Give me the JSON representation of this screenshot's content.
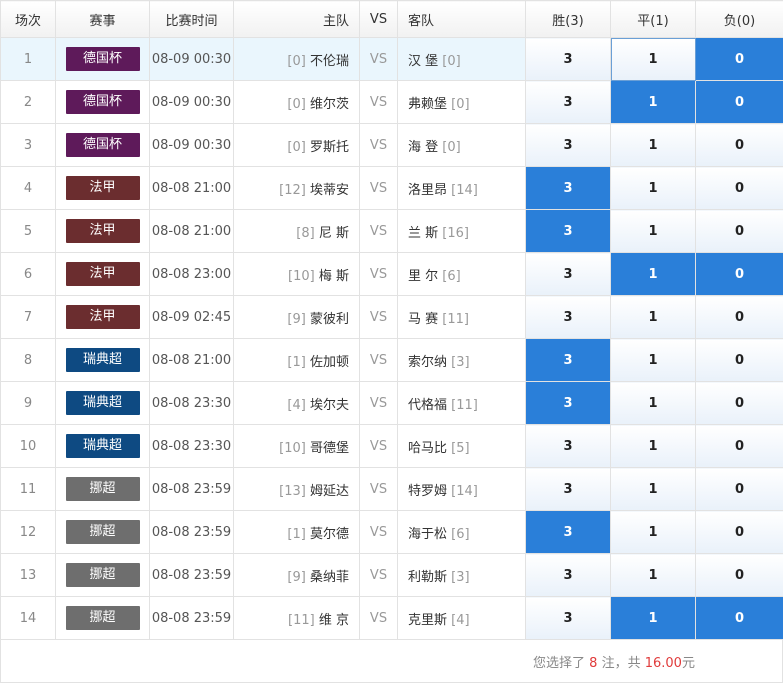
{
  "header": {
    "col_no": "场次",
    "col_league": "赛事",
    "col_time": "比赛时间",
    "col_home": "主队",
    "col_vs": "VS",
    "col_away": "客队",
    "col_win": "胜(3)",
    "col_draw": "平(1)",
    "col_loss": "负(0)"
  },
  "colors": {
    "德国杯": "#5e1a5a",
    "法甲": "#6b2d2f",
    "瑞典超": "#0e4a82",
    "挪超": "#6e6e6e",
    "selected": "#2a7fd9"
  },
  "rows": [
    {
      "no": "1",
      "league": "德国杯",
      "time": "08-09 00:30",
      "home_rank": "[0]",
      "home": "不伦瑞",
      "vs": "VS",
      "away": "汉 堡",
      "away_rank": "[0]",
      "win": "3",
      "draw": "1",
      "loss": "0",
      "sel": [
        "loss"
      ],
      "focus": "draw",
      "hl": true
    },
    {
      "no": "2",
      "league": "德国杯",
      "time": "08-09 00:30",
      "home_rank": "[0]",
      "home": "维尔茨",
      "vs": "VS",
      "away": "弗赖堡",
      "away_rank": "[0]",
      "win": "3",
      "draw": "1",
      "loss": "0",
      "sel": [
        "draw",
        "loss"
      ]
    },
    {
      "no": "3",
      "league": "德国杯",
      "time": "08-09 00:30",
      "home_rank": "[0]",
      "home": "罗斯托",
      "vs": "VS",
      "away": "海 登",
      "away_rank": "[0]",
      "win": "3",
      "draw": "1",
      "loss": "0",
      "sel": []
    },
    {
      "no": "4",
      "league": "法甲",
      "time": "08-08 21:00",
      "home_rank": "[12]",
      "home": "埃蒂安",
      "vs": "VS",
      "away": "洛里昂",
      "away_rank": "[14]",
      "win": "3",
      "draw": "1",
      "loss": "0",
      "sel": [
        "win"
      ]
    },
    {
      "no": "5",
      "league": "法甲",
      "time": "08-08 21:00",
      "home_rank": "[8]",
      "home": "尼 斯",
      "vs": "VS",
      "away": "兰 斯",
      "away_rank": "[16]",
      "win": "3",
      "draw": "1",
      "loss": "0",
      "sel": [
        "win"
      ]
    },
    {
      "no": "6",
      "league": "法甲",
      "time": "08-08 23:00",
      "home_rank": "[10]",
      "home": "梅 斯",
      "vs": "VS",
      "away": "里 尔",
      "away_rank": "[6]",
      "win": "3",
      "draw": "1",
      "loss": "0",
      "sel": [
        "draw",
        "loss"
      ]
    },
    {
      "no": "7",
      "league": "法甲",
      "time": "08-09 02:45",
      "home_rank": "[9]",
      "home": "蒙彼利",
      "vs": "VS",
      "away": "马 赛",
      "away_rank": "[11]",
      "win": "3",
      "draw": "1",
      "loss": "0",
      "sel": []
    },
    {
      "no": "8",
      "league": "瑞典超",
      "time": "08-08 21:00",
      "home_rank": "[1]",
      "home": "佐加顿",
      "vs": "VS",
      "away": "索尔纳",
      "away_rank": "[3]",
      "win": "3",
      "draw": "1",
      "loss": "0",
      "sel": [
        "win"
      ]
    },
    {
      "no": "9",
      "league": "瑞典超",
      "time": "08-08 23:30",
      "home_rank": "[4]",
      "home": "埃尔夫",
      "vs": "VS",
      "away": "代格福",
      "away_rank": "[11]",
      "win": "3",
      "draw": "1",
      "loss": "0",
      "sel": [
        "win"
      ]
    },
    {
      "no": "10",
      "league": "瑞典超",
      "time": "08-08 23:30",
      "home_rank": "[10]",
      "home": "哥德堡",
      "vs": "VS",
      "away": "哈马比",
      "away_rank": "[5]",
      "win": "3",
      "draw": "1",
      "loss": "0",
      "sel": []
    },
    {
      "no": "11",
      "league": "挪超",
      "time": "08-08 23:59",
      "home_rank": "[13]",
      "home": "姆延达",
      "vs": "VS",
      "away": "特罗姆",
      "away_rank": "[14]",
      "win": "3",
      "draw": "1",
      "loss": "0",
      "sel": []
    },
    {
      "no": "12",
      "league": "挪超",
      "time": "08-08 23:59",
      "home_rank": "[1]",
      "home": "莫尔德",
      "vs": "VS",
      "away": "海于松",
      "away_rank": "[6]",
      "win": "3",
      "draw": "1",
      "loss": "0",
      "sel": [
        "win"
      ]
    },
    {
      "no": "13",
      "league": "挪超",
      "time": "08-08 23:59",
      "home_rank": "[9]",
      "home": "桑纳菲",
      "vs": "VS",
      "away": "利勒斯",
      "away_rank": "[3]",
      "win": "3",
      "draw": "1",
      "loss": "0",
      "sel": []
    },
    {
      "no": "14",
      "league": "挪超",
      "time": "08-08 23:59",
      "home_rank": "[11]",
      "home": "维 京",
      "vs": "VS",
      "away": "克里斯",
      "away_rank": "[4]",
      "win": "3",
      "draw": "1",
      "loss": "0",
      "sel": [
        "draw",
        "loss"
      ]
    }
  ],
  "summary": {
    "prefix": "您选择了",
    "count": "8",
    "mid": "注，共",
    "amount": "16.00",
    "suffix": "元"
  }
}
